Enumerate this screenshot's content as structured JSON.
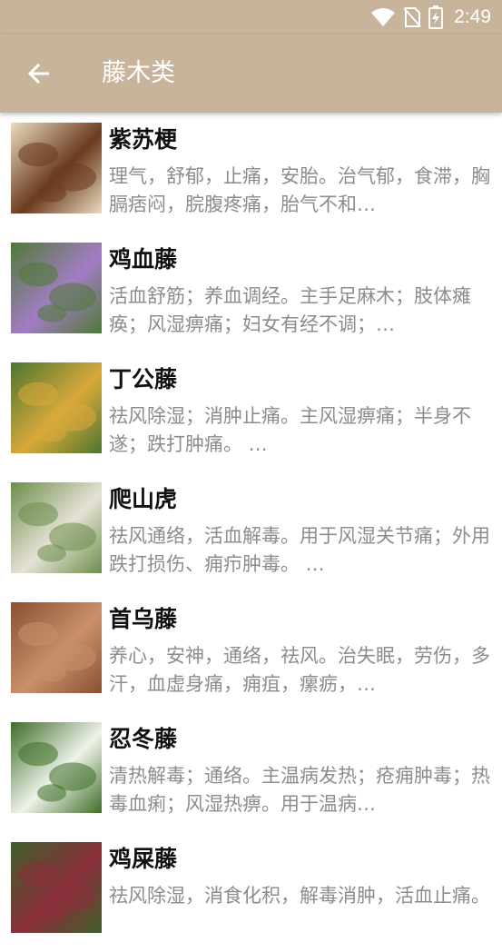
{
  "status_bar": {
    "time": "2:49"
  },
  "app_bar": {
    "title": "藤木类"
  },
  "items": [
    {
      "name": "紫苏梗",
      "desc": "理气，舒郁，止痛，安胎。治气郁，食滞，胸膈痞闷，脘腹疼痛，胎气不和…",
      "thumb_icon": "perilla-stem-image",
      "thumb_colors": [
        "#e9dcc0",
        "#6b3a1f"
      ]
    },
    {
      "name": "鸡血藤",
      "desc": "活血舒筋；养血调经。主手足麻木；肢体瘫痪；风湿痹痛；妇女有经不调；…",
      "thumb_icon": "spatholobus-flower-image",
      "thumb_colors": [
        "#4f7a36",
        "#a27cc4"
      ]
    },
    {
      "name": "丁公藤",
      "desc": "祛风除湿；消肿止痛。主风湿痹痛；半身不遂；跌打肿痛。 …",
      "thumb_icon": "erycibe-leaf-image",
      "thumb_colors": [
        "#4c7530",
        "#d9a93a"
      ]
    },
    {
      "name": "爬山虎",
      "desc": "祛风通络，活血解毒。用于风湿关节痛；外用跌打损伤、痈疖肿毒。 …",
      "thumb_icon": "boston-ivy-image",
      "thumb_colors": [
        "#6c8d4a",
        "#e6e2d6"
      ]
    },
    {
      "name": "首乌藤",
      "desc": "养心，安神，通络，祛风。治失眠，劳伤，多汗，血虚身痛，痈疽，瘰疬，…",
      "thumb_icon": "polygonum-vine-image",
      "thumb_colors": [
        "#8a5032",
        "#c9906a"
      ]
    },
    {
      "name": "忍冬藤",
      "desc": "清热解毒；通络。主温病发热；疮痈肿毒；热毒血痢；风湿热痹。用于温病…",
      "thumb_icon": "honeysuckle-image",
      "thumb_colors": [
        "#3e6e27",
        "#eef2ea"
      ]
    },
    {
      "name": "鸡屎藤",
      "desc": "祛风除湿，消食化积，解毒消肿，活血止痛。",
      "thumb_icon": "paederia-vine-image",
      "thumb_colors": [
        "#3f5f2c",
        "#8a2f3a"
      ]
    }
  ]
}
